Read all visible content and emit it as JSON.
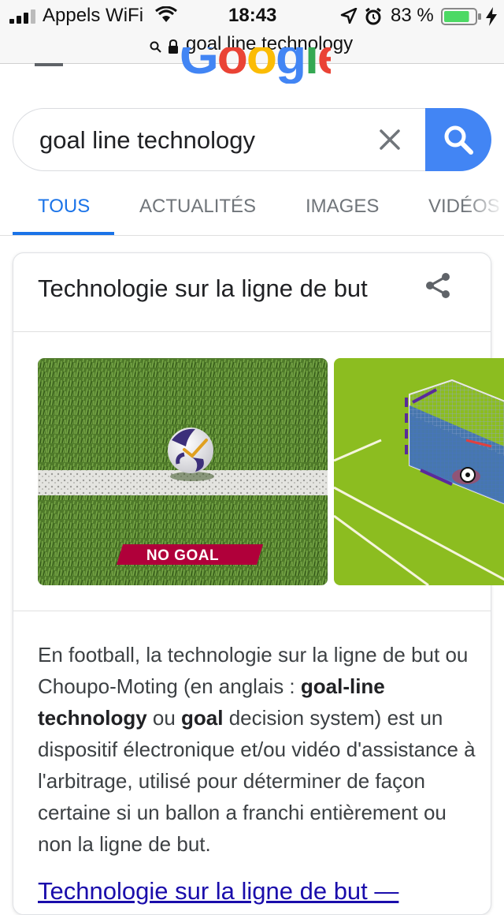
{
  "status_bar": {
    "carrier": "Appels WiFi",
    "time": "18:43",
    "battery_percent": "83 %",
    "battery_level": 0.83,
    "battery_color": "#4cd964",
    "icons": [
      "signal-icon",
      "wifi-icon",
      "location-arrow-icon",
      "alarm-icon",
      "battery-icon",
      "charging-bolt-icon"
    ]
  },
  "url_bar": {
    "text": "goal line technology"
  },
  "header": {
    "logo_text": "Google",
    "logo_colors": [
      "#4285f4",
      "#ea4335",
      "#fbbc05",
      "#4285f4",
      "#34a853",
      "#ea4335"
    ]
  },
  "search": {
    "value": "goal line technology",
    "accent_color": "#4285f4"
  },
  "tabs": [
    {
      "label": "TOUS",
      "active": true
    },
    {
      "label": "ACTUALITÉS",
      "active": false
    },
    {
      "label": "IMAGES",
      "active": false
    },
    {
      "label": "VIDÉOS",
      "active": false
    }
  ],
  "knowledge_panel": {
    "title": "Technologie sur la ligne de but",
    "images": [
      {
        "overlay_text": "NO GOAL"
      }
    ],
    "description": {
      "p1": "En football, la technologie sur la ligne de but ou Choupo-Moting (en anglais : ",
      "b1": "goal-line technology",
      "p2": " ou ",
      "b2": "goal",
      "p3": " decision system) est un dispositif électronique et/ou vidéo d'assistance à l'arbitrage, utilisé pour déterminer de façon certaine si un ballon a franchi entièrement ou non la ligne de but."
    },
    "link_text": "Technologie sur la ligne de but —"
  }
}
